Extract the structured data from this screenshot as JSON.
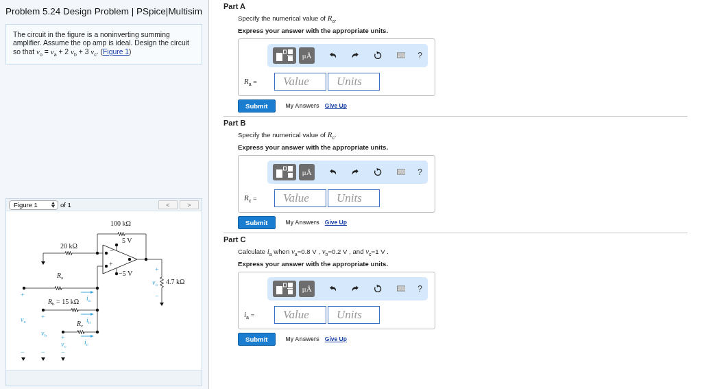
{
  "problem": {
    "title": "Problem 5.24 Design Problem | PSpice|Multisim",
    "statement": {
      "text": "The circuit in the figure is a noninverting summing amplifier. Assume the op amp is ideal. Design the circuit so that *v*$_{o}$ = *v*$_{a}$ + 2 *v*$_{b}$ + 3 *v*$_{c}$. (",
      "link": "Figure 1",
      "after": ")"
    }
  },
  "figure": {
    "select": "Figure 1",
    "of": "of 1",
    "prev": {
      "label": "<",
      "disabled": true
    },
    "next": {
      "label": ">",
      "disabled": true
    },
    "labels": [
      {
        "text": "100 kΩ",
        "kind": "component"
      },
      {
        "text": "5 V",
        "kind": "component"
      },
      {
        "text": "20 kΩ",
        "kind": "component"
      },
      {
        "text": "−",
        "kind": "component"
      },
      {
        "text": "+",
        "kind": "component"
      },
      {
        "text": "+",
        "kind": "signal"
      },
      {
        "text": "−5 V",
        "kind": "component"
      },
      {
        "text": "*R*$_{a}$",
        "kind": "component"
      },
      {
        "text": "*v*$_{o}$",
        "kind": "signal"
      },
      {
        "text": "4.7 kΩ",
        "kind": "component"
      },
      {
        "text": "+",
        "kind": "signal"
      },
      {
        "text": "*i*$_{a}$",
        "kind": "signal"
      },
      {
        "text": "−",
        "kind": "signal"
      },
      {
        "text": "*R*$_{b}$ = 15 kΩ",
        "kind": "component"
      },
      {
        "text": "*v*$_{a}$",
        "kind": "signal"
      },
      {
        "text": "+",
        "kind": "signal"
      },
      {
        "text": "*i*$_{b}$",
        "kind": "signal"
      },
      {
        "text": "*R*$_{c}$",
        "kind": "component"
      },
      {
        "text": "*v*$_{b}$",
        "kind": "signal"
      },
      {
        "text": "+",
        "kind": "signal"
      },
      {
        "text": "*i*$_{c}$",
        "kind": "signal"
      },
      {
        "text": "*v*$_{c}$",
        "kind": "signal"
      },
      {
        "text": "−",
        "kind": "signal"
      },
      {
        "text": "−",
        "kind": "signal"
      },
      {
        "text": "−",
        "kind": "signal"
      }
    ]
  },
  "parts": [
    {
      "title": "Part A",
      "prompt": "Specify the numerical value of *R*$_{a}$.",
      "instruction": "Express your answer with the appropriate units.",
      "units_button": "μÅ",
      "help": "?",
      "answer_label": "*R*$_{a}$ =",
      "value_placeholder": "Value",
      "units_placeholder": "Units",
      "submit": "Submit",
      "my_answers": "My Answers",
      "give_up": "Give Up"
    },
    {
      "title": "Part B",
      "prompt": "Specify the numerical value of *R*$_{c}$.",
      "instruction": "Express your answer with the appropriate units.",
      "units_button": "μÅ",
      "help": "?",
      "answer_label": "*R*$_{c}$ =",
      "value_placeholder": "Value",
      "units_placeholder": "Units",
      "submit": "Submit",
      "my_answers": "My Answers",
      "give_up": "Give Up"
    },
    {
      "title": "Part C",
      "prompt": "Calculate *i*$_{a}$ when *v*$_{a}$=0.8 V , *v*$_{b}$=0.2 V , and *v*$_{c}$=1 V .",
      "instruction": "Express your answer with the appropriate units.",
      "units_button": "μÅ",
      "help": "?",
      "answer_label": "*i*$_{a}$ =",
      "value_placeholder": "Value",
      "units_placeholder": "Units",
      "submit": "Submit",
      "my_answers": "My Answers",
      "give_up": "Give Up"
    }
  ]
}
